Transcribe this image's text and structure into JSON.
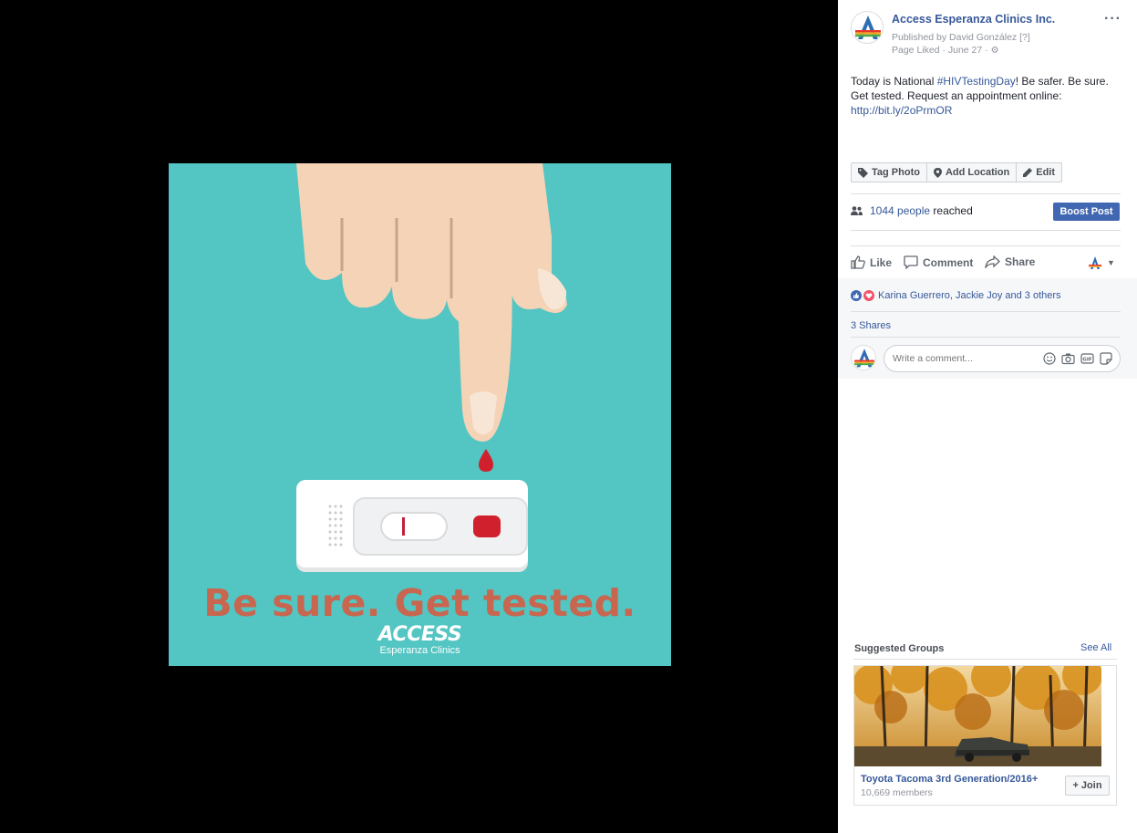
{
  "photo": {
    "headline": "Be sure. Get tested.",
    "logo_main": "ACCESS",
    "logo_sub": "Esperanza Clinics"
  },
  "post": {
    "page_name": "Access Esperanza Clinics Inc.",
    "published_by": "Published by David González [?]",
    "meta": "Page Liked · June 27 ·",
    "more": "···",
    "text_pre": "Today is National ",
    "hashtag": "#HIVTestingDay",
    "text_mid": "! Be safer. Be sure. Get tested. Request an appointment online: ",
    "link": "http://bit.ly/2oPrmOR"
  },
  "toolbar": {
    "tag_photo": "Tag Photo",
    "add_location": "Add Location",
    "edit": "Edit"
  },
  "reach": {
    "count": "1044 people",
    "suffix": " reached",
    "boost": "Boost Post"
  },
  "actions": {
    "like": "Like",
    "comment": "Comment",
    "share": "Share"
  },
  "feedback": {
    "reactors": "Karina Guerrero, Jackie Joy and 3 others",
    "shares": "3 Shares",
    "comment_placeholder": "Write a comment..."
  },
  "suggested": {
    "title": "Suggested Groups",
    "see_all": "See All",
    "group_name": "Toyota Tacoma 3rd Generation/2016+",
    "members": "10,669 members",
    "join": "+ Join"
  },
  "colors": {
    "link": "#365899",
    "boost": "#4267b2",
    "photo_bg": "#53c5c2",
    "headline": "#c8664f"
  }
}
